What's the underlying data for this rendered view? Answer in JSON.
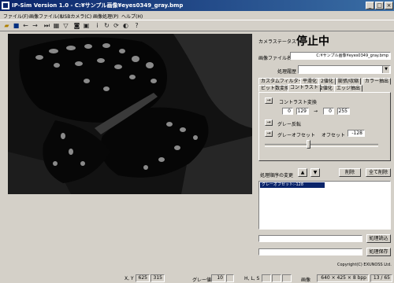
{
  "window": {
    "title": "IP-Sim Version 1.0 - C:¥サンプル画像¥eyes0349_gray.bmp"
  },
  "menu": [
    "ファイル(F)",
    "画像ファイル(I)",
    "USBカメラ(C)",
    "画像処理(P)",
    "ヘルプ(H)"
  ],
  "camera": {
    "status_label": "カメラステータス",
    "status": "停止中"
  },
  "image_file": {
    "label": "画像ファイル名",
    "value": "C:¥サンプル画像¥eyes0349_gray.bmp"
  },
  "process_history": {
    "label": "処理履歴",
    "value": ""
  },
  "tabs": {
    "row1": [
      "カスタムフィルター",
      "平滑化",
      "2値化",
      "膨張/収縮",
      "カラー抽出"
    ],
    "row2": [
      "ビット数変換",
      "コントラスト",
      "2値化",
      "エッジ抽出"
    ],
    "active": "コントラスト"
  },
  "contrast": {
    "header": "コントラスト変換",
    "from_min": "0",
    "from_max": "129",
    "arrow": "→",
    "to_min": "0",
    "to_max": "255",
    "gray_invert": "グレー反転",
    "gray_offset": "グレーオフセット",
    "offset_label": "オフセット",
    "offset_value": "-128",
    "slider_level": 0.38
  },
  "order": {
    "label": "処理順序の変更",
    "up": "▲",
    "down": "▼",
    "delete": "削除",
    "delete_all": "全て削除",
    "list": [
      "グレーオフセット:-128"
    ]
  },
  "buttons": {
    "load": "処理読込",
    "save": "処理保存"
  },
  "copyright": "Copyright(C) EXUNOSS Ltd.",
  "statusbar": {
    "xy_label": "X, Y",
    "x": "625",
    "y": "315",
    "gray_label": "グレー値",
    "gray": "10",
    "hls_label": "H, L, S",
    "img_label": "画像",
    "size": "640 × 425 × 8 bpp",
    "page": "13 / 65"
  }
}
